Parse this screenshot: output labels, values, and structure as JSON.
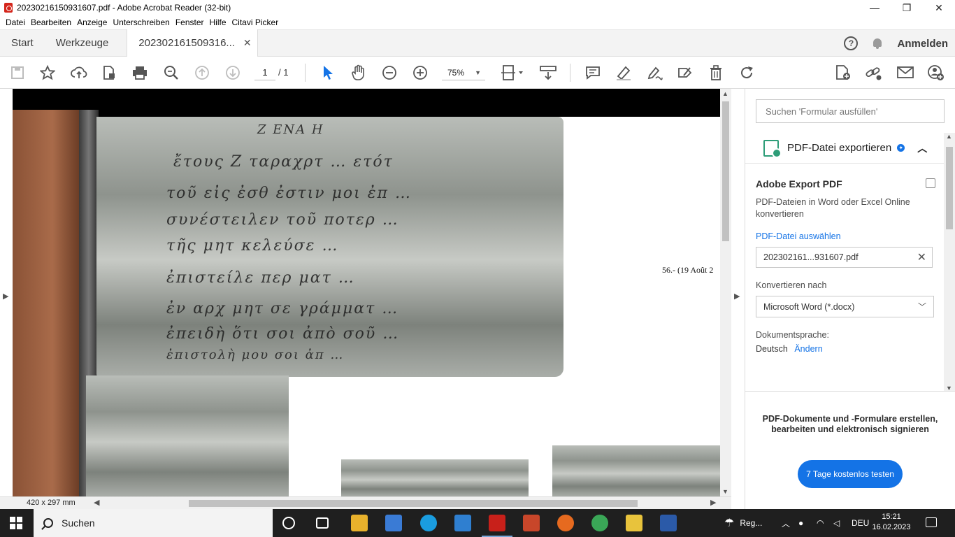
{
  "window": {
    "title": "20230216150931607.pdf - Adobe Acrobat Reader (32-bit)",
    "minimize": "—",
    "maximize": "❐",
    "close": "✕"
  },
  "menu": [
    "Datei",
    "Bearbeiten",
    "Anzeige",
    "Unterschreiben",
    "Fenster",
    "Hilfe",
    "Citavi Picker"
  ],
  "tabs": {
    "home": "Start",
    "tools": "Werkzeuge",
    "document": "202302161509316...",
    "close": "✕",
    "help": "?",
    "signin": "Anmelden"
  },
  "toolbar": {
    "page_current": "1",
    "page_total": "/ 1",
    "zoom": "75%"
  },
  "document": {
    "script_lines": [
      "Ζ ΕΝΑ Η",
      "ἔτους Ζ ταραχρτ … ετότ",
      "τοῦ εἰς ἐσθ ἐστιν μοι ἐπ …",
      "συνέστειλεν τοῦ ποτερ …",
      "τῆς μητ κελεύσε …",
      "ἐπιστείλε περ ματ …",
      "ἐν αρχ μητ σε γράμματ …",
      "ἐπειδὴ ὅτι σοι ἀπὸ σοῦ …",
      "ἐπιστολὴ μου σοι ἀπ …"
    ],
    "page_label": "56.- (19 Août 2",
    "size": "420 x 297 mm"
  },
  "right_pane": {
    "search_placeholder": "Suchen 'Formular ausfüllen'",
    "export_title": "PDF-Datei exportieren",
    "export_heading": "Adobe Export PDF",
    "export_desc": "PDF-Dateien in Word oder Excel Online konvertieren",
    "select_file": "PDF-Datei auswählen",
    "file_name": "202302161...931607.pdf",
    "convert_label": "Konvertieren nach",
    "convert_value": "Microsoft Word (*.docx)",
    "lang_label": "Dokumentsprache:",
    "lang_value": "Deutsch",
    "lang_change": "Ändern",
    "promo": "PDF-Dokumente und -Formulare erstellen, bearbeiten und elektronisch signieren",
    "trial": "7 Tage kostenlos testen"
  },
  "taskbar": {
    "search": "Suchen",
    "weather": "Reg...",
    "lang": "DEU",
    "time": "15:21",
    "date": "16.02.2023"
  }
}
